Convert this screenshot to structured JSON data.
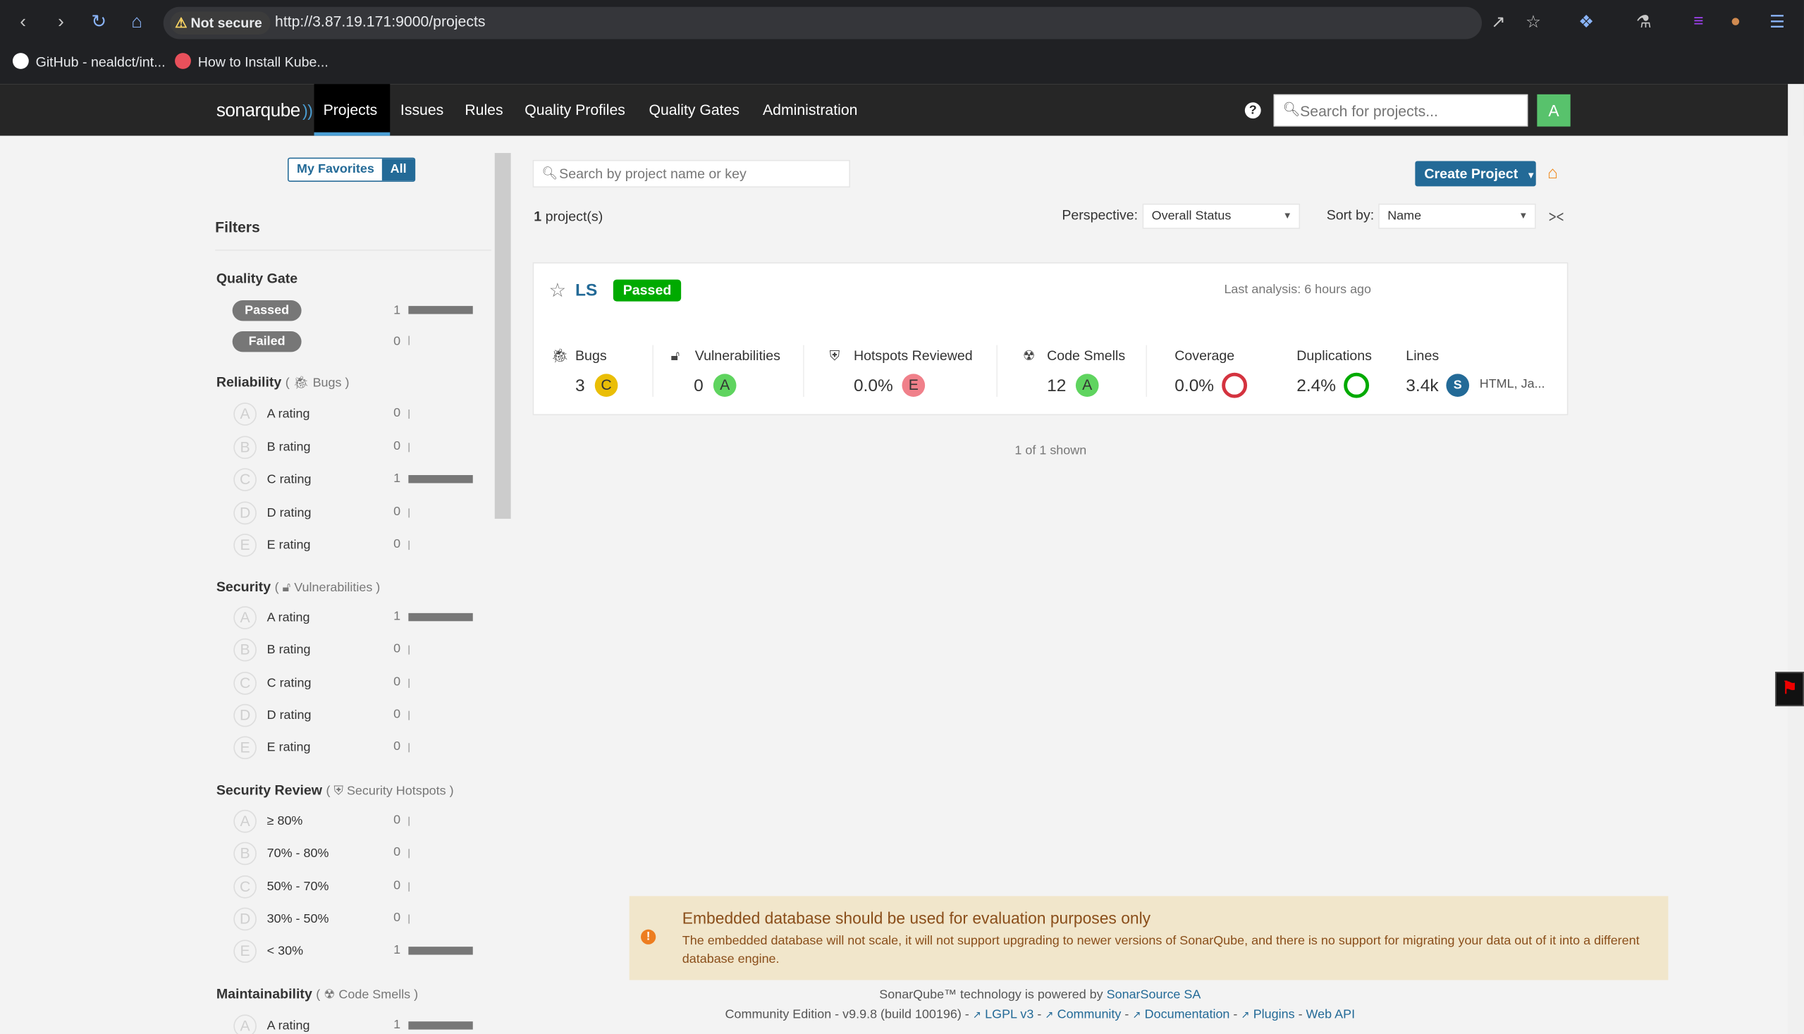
{
  "browser": {
    "not_secure": "Not secure",
    "url": "http://3.87.19.171:9000/projects",
    "bookmarks": [
      "GitHub - nealdct/int...",
      "How to Install Kube..."
    ]
  },
  "header": {
    "logo": "sonarqube",
    "nav": [
      "Projects",
      "Issues",
      "Rules",
      "Quality Profiles",
      "Quality Gates",
      "Administration"
    ],
    "search_placeholder": "Search for projects...",
    "avatar": "A",
    "help": "?"
  },
  "sidebar": {
    "favorites": "My Favorites",
    "all": "All",
    "filters_title": "Filters",
    "quality_gate": {
      "title": "Quality Gate",
      "items": [
        {
          "label": "Passed",
          "count": "1"
        },
        {
          "label": "Failed",
          "count": "0"
        }
      ]
    },
    "reliability": {
      "title": "Reliability",
      "sub": "Bugs",
      "items": [
        {
          "letter": "A",
          "label": "A rating",
          "count": "0"
        },
        {
          "letter": "B",
          "label": "B rating",
          "count": "0"
        },
        {
          "letter": "C",
          "label": "C rating",
          "count": "1"
        },
        {
          "letter": "D",
          "label": "D rating",
          "count": "0"
        },
        {
          "letter": "E",
          "label": "E rating",
          "count": "0"
        }
      ]
    },
    "security": {
      "title": "Security",
      "sub": "Vulnerabilities",
      "items": [
        {
          "letter": "A",
          "label": "A rating",
          "count": "1"
        },
        {
          "letter": "B",
          "label": "B rating",
          "count": "0"
        },
        {
          "letter": "C",
          "label": "C rating",
          "count": "0"
        },
        {
          "letter": "D",
          "label": "D rating",
          "count": "0"
        },
        {
          "letter": "E",
          "label": "E rating",
          "count": "0"
        }
      ]
    },
    "security_review": {
      "title": "Security Review",
      "sub": "Security Hotspots",
      "items": [
        {
          "letter": "A",
          "label": "≥ 80%",
          "count": "0"
        },
        {
          "letter": "B",
          "label": "70% - 80%",
          "count": "0"
        },
        {
          "letter": "C",
          "label": "50% - 70%",
          "count": "0"
        },
        {
          "letter": "D",
          "label": "30% - 50%",
          "count": "0"
        },
        {
          "letter": "E",
          "label": "< 30%",
          "count": "1"
        }
      ]
    },
    "maintainability": {
      "title": "Maintainability",
      "sub": "Code Smells",
      "items": [
        {
          "letter": "A",
          "label": "A rating",
          "count": "1"
        }
      ]
    }
  },
  "main": {
    "search_placeholder": "Search by project name or key",
    "create_project": "Create Project",
    "project_count_num": "1",
    "project_count_text": "project(s)",
    "perspective_label": "Perspective:",
    "perspective_value": "Overall Status",
    "sort_label": "Sort by:",
    "sort_value": "Name",
    "project": {
      "name": "LS",
      "status": "Passed",
      "last_analysis": "Last analysis: 6 hours ago",
      "metrics": {
        "bugs": {
          "label": "Bugs",
          "value": "3",
          "rating": "C"
        },
        "vulnerabilities": {
          "label": "Vulnerabilities",
          "value": "0",
          "rating": "A"
        },
        "hotspots": {
          "label": "Hotspots Reviewed",
          "value": "0.0%",
          "rating": "E"
        },
        "code_smells": {
          "label": "Code Smells",
          "value": "12",
          "rating": "A"
        },
        "coverage": {
          "label": "Coverage",
          "value": "0.0%"
        },
        "duplications": {
          "label": "Duplications",
          "value": "2.4%"
        },
        "lines": {
          "label": "Lines",
          "value": "3.4k",
          "size": "S",
          "languages": "HTML, Ja..."
        }
      }
    },
    "shown": "1 of 1 shown"
  },
  "warning": {
    "title": "Embedded database should be used for evaluation purposes only",
    "text": "The embedded database will not scale, it will not support upgrading to newer versions of SonarQube, and there is no support for migrating your data out of it into a different database engine."
  },
  "footer": {
    "powered": "SonarQube™ technology is powered by",
    "sonarsource": "SonarSource SA",
    "edition": "Community Edition - v9.9.8 (build 100196) -",
    "links": [
      "LGPL v3",
      "Community",
      "Documentation",
      "Plugins",
      "Web API"
    ]
  },
  "colors": {
    "rating_A": "#00aa00",
    "rating_C": "#eabe06",
    "rating_E": "#d4333f",
    "accent": "#236a97"
  }
}
